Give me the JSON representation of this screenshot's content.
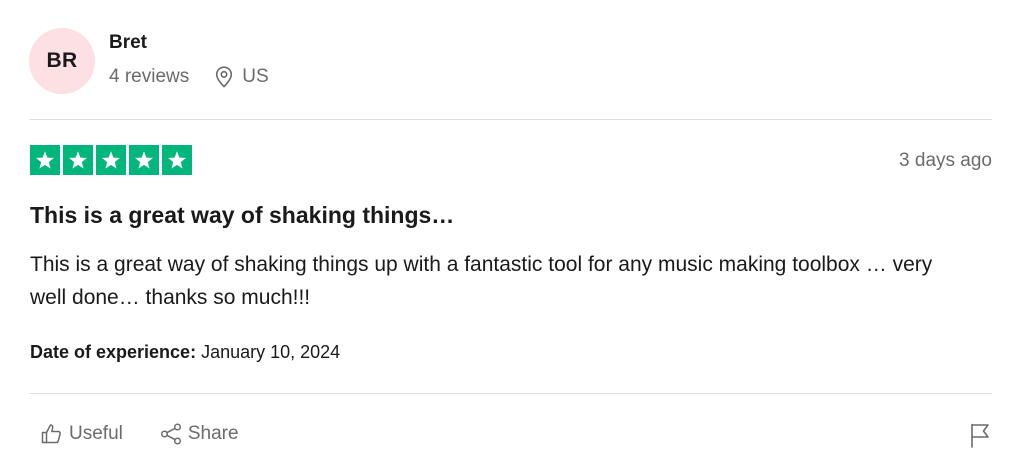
{
  "reviewer": {
    "initials": "BR",
    "name": "Bret",
    "review_count": "4 reviews",
    "country": "US",
    "avatar_color": "#fde0e4"
  },
  "review": {
    "rating": 5,
    "rating_max": 5,
    "star_color": "#00b67a",
    "posted": "3 days ago",
    "title": "This is a great way of shaking things…",
    "body": "This is a great way of shaking things up with a fantastic tool for any music making toolbox … very well done… thanks so much!!!",
    "experience_label": "Date of experience:",
    "experience_date": "January 10, 2024"
  },
  "actions": {
    "useful_label": "Useful",
    "useful_icon": "thumbs-up-icon",
    "share_label": "Share",
    "share_icon": "share-icon",
    "report_icon": "flag-icon"
  }
}
